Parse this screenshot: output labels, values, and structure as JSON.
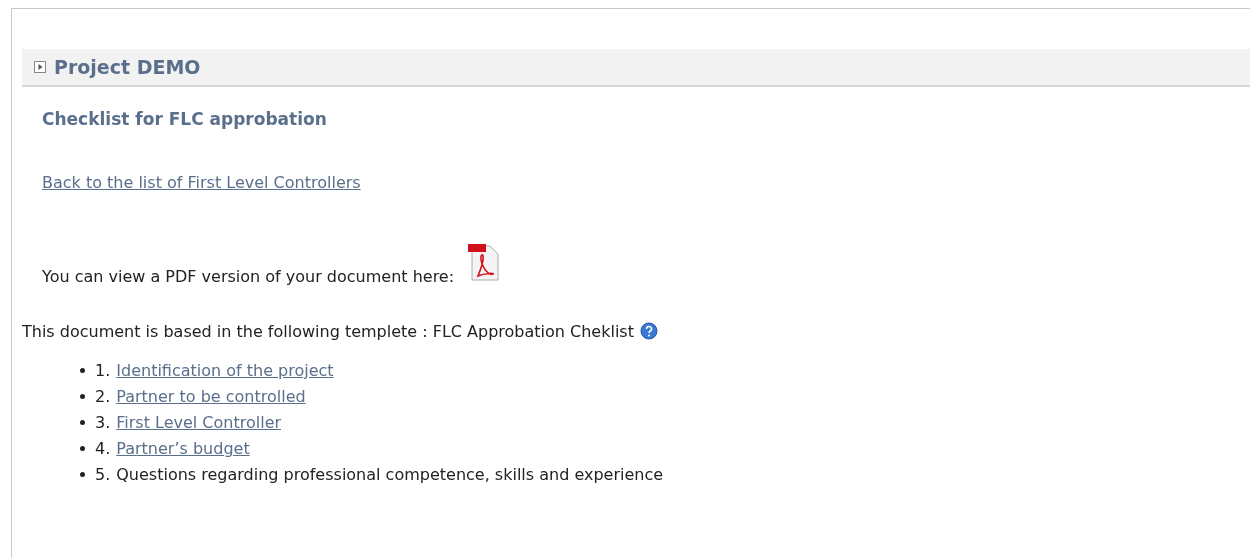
{
  "section": {
    "title": "Project DEMO",
    "expanded": false
  },
  "heading": "Checklist for FLC approbation",
  "back_link": "Back to the list of First Level Controllers",
  "pdf_text": "You can view a PDF version of your document here:",
  "template_text": "This document is based in the following templete : FLC Approbation Cheklist",
  "items": [
    {
      "number": "1.",
      "label": "Identification of the project",
      "kind": "link"
    },
    {
      "number": "2.",
      "label": "Partner to be controlled",
      "kind": "link"
    },
    {
      "number": "3.",
      "label": "First Level Controller",
      "kind": "link"
    },
    {
      "number": "4.",
      "label": "Partner’s budget",
      "kind": "link"
    },
    {
      "number": "5.",
      "label": "Questions regarding professional competence, skills and experience",
      "kind": "text"
    }
  ]
}
